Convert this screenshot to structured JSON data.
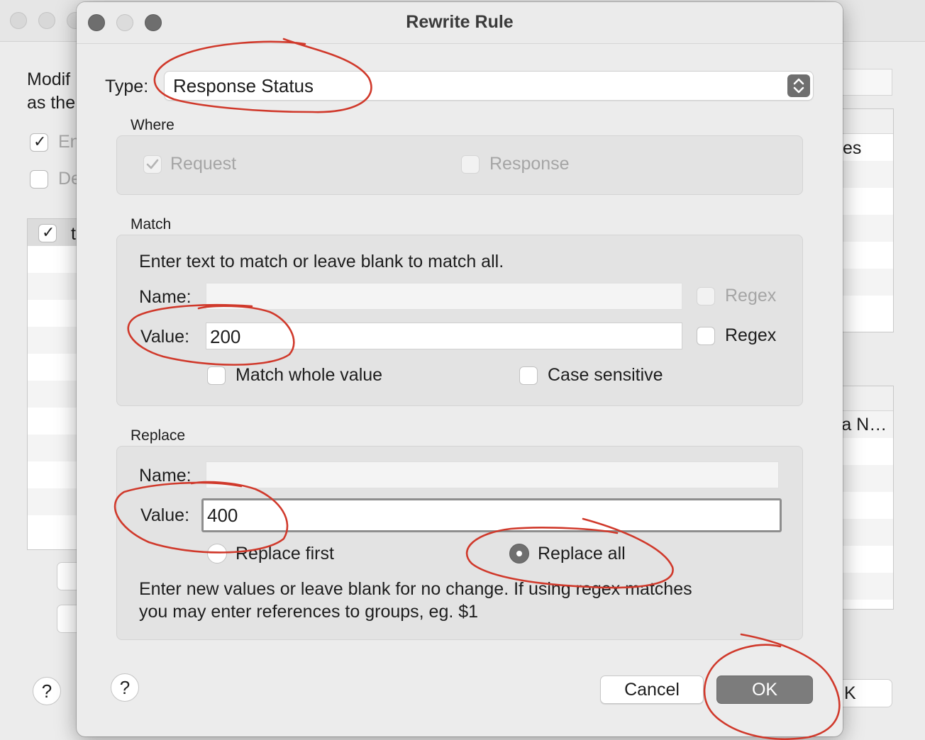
{
  "background_window": {
    "description_text_line1": "Modif",
    "description_text_line2": "as the",
    "checkbox1_label": "En",
    "checkbox2_label": "De",
    "list_first_row_label": "t",
    "right_list_header": "es",
    "right_list2_text": "ra N…",
    "ok_button_label": "K",
    "help_label": "?"
  },
  "dialog": {
    "title": "Rewrite Rule",
    "type_label": "Type:",
    "type_value": "Response Status",
    "where": {
      "section_label": "Where",
      "request_label": "Request",
      "request_checked": true,
      "response_label": "Response",
      "response_checked": false
    },
    "match": {
      "section_label": "Match",
      "instructions": "Enter text to match or leave blank to match all.",
      "name_label": "Name:",
      "name_value": "",
      "name_regex_label": "Regex",
      "value_label": "Value:",
      "value_value": "200",
      "value_regex_label": "Regex",
      "match_whole_label": "Match whole value",
      "case_sensitive_label": "Case sensitive"
    },
    "replace": {
      "section_label": "Replace",
      "name_label": "Name:",
      "name_value": "",
      "value_label": "Value:",
      "value_value": "400",
      "replace_first_label": "Replace first",
      "replace_all_label": "Replace all",
      "selected_mode": "Replace all",
      "instructions_line1": "Enter new values or leave blank for no change. If using regex matches",
      "instructions_line2": "you may enter references to groups, eg. $1"
    },
    "help_label": "?",
    "cancel_label": "Cancel",
    "ok_label": "OK"
  },
  "colors": {
    "annotation_red": "#d0392b",
    "ok_button": "#7c7c7c",
    "window_bg": "#ececec"
  }
}
